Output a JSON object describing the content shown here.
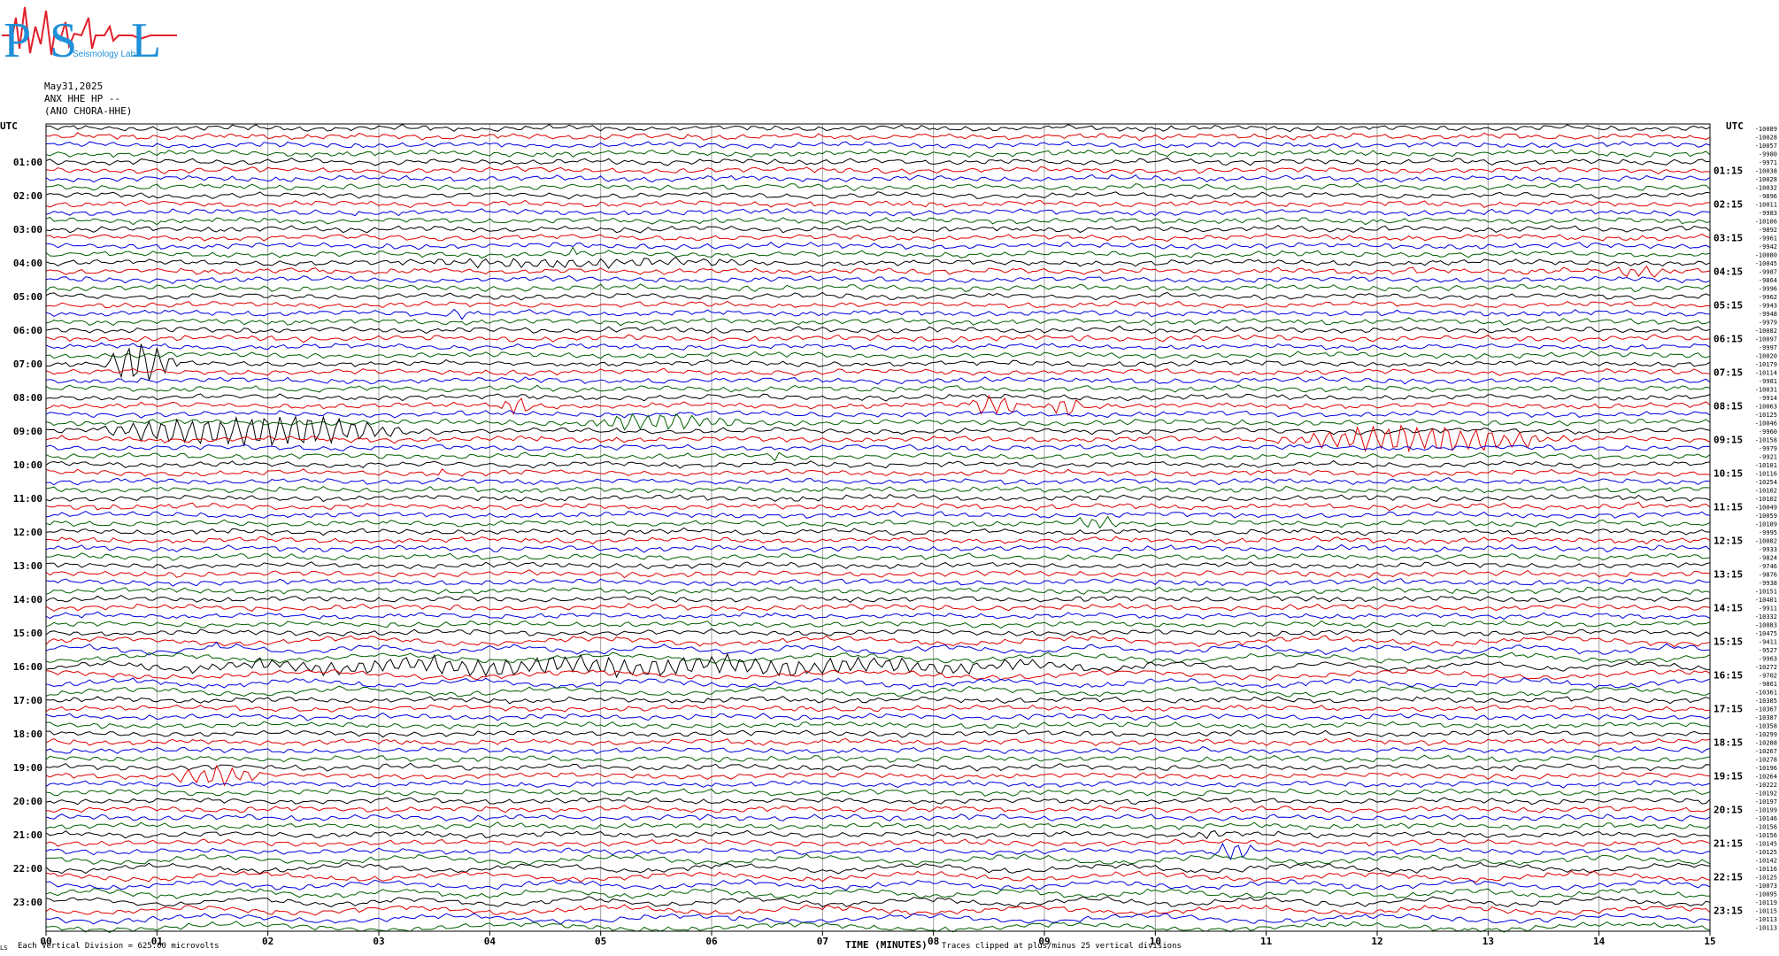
{
  "logo": {
    "big_letters": [
      "P",
      "S",
      "L"
    ],
    "small_text": "Seismology Lab",
    "colors": {
      "letters": "#1f8fd8",
      "wave": "#e0202a"
    }
  },
  "header": {
    "date": "May31,2025",
    "station": "ANX HHE HP --",
    "site": "(ANO CHORA-HHE)"
  },
  "footer": {
    "division_note": "Each Vertical Division =  625.00 microvolts",
    "xlabel": "TIME (MINUTES)",
    "clip_note": "Traces clipped at plus/minus 25 vertical divisions",
    "corner_mark": "LS"
  },
  "chart_data": {
    "type": "line",
    "title": "",
    "xlabel": "TIME (MINUTES)",
    "xlim": [
      0,
      15
    ],
    "x_ticks": [
      "00",
      "01",
      "02",
      "03",
      "04",
      "05",
      "06",
      "07",
      "08",
      "09",
      "10",
      "11",
      "12",
      "13",
      "14",
      "15"
    ],
    "left_axis_label": "UTC",
    "right_axis_label": "UTC",
    "left_time_labels": [
      "01:00",
      "02:00",
      "03:00",
      "04:00",
      "05:00",
      "06:00",
      "07:00",
      "08:00",
      "09:00",
      "10:00",
      "11:00",
      "12:00",
      "13:00",
      "14:00",
      "15:00",
      "16:00",
      "17:00",
      "18:00",
      "19:00",
      "20:00",
      "21:00",
      "22:00",
      "23:00"
    ],
    "right_time_labels": [
      "01:15",
      "02:15",
      "03:15",
      "04:15",
      "05:15",
      "06:15",
      "07:15",
      "08:15",
      "09:15",
      "10:15",
      "11:15",
      "12:15",
      "13:15",
      "14:15",
      "15:15",
      "16:15",
      "17:15",
      "18:15",
      "19:15",
      "20:15",
      "21:15",
      "22:15",
      "23:15"
    ],
    "trace_count": 96,
    "trace_color_cycle": [
      "#000000",
      "#e00000",
      "#0000e0",
      "#006000"
    ],
    "trace_offsets": [
      "-10089",
      "-10028",
      "-10057",
      "-9980",
      "-9971",
      "-10038",
      "-10028",
      "-10032",
      "-9896",
      "-10011",
      "-9983",
      "-10106",
      "-9892",
      "-9961",
      "-9942",
      "-10080",
      "-10045",
      "-9987",
      "-9864",
      "-9996",
      "-9962",
      "-9943",
      "-9948",
      "-9979",
      "-10082",
      "-10097",
      "-9997",
      "-10020",
      "-10179",
      "-10114",
      "-9981",
      "-10031",
      "-9914",
      "-10063",
      "-10125",
      "-10046",
      "-9960",
      "-10158",
      "-9979",
      "-9921",
      "-10101",
      "-10116",
      "-10254",
      "-10102",
      "-10102",
      "-10049",
      "-10059",
      "-10189",
      "-9995",
      "-10082",
      "-9933",
      "-9824",
      "-9746",
      "-9876",
      "-9938",
      "-10151",
      "-10401",
      "-9911",
      "-10332",
      "-10083",
      "-10475",
      "-9411",
      "-9527",
      "-9963",
      "-10272",
      "-9702",
      "-9861",
      "-10361",
      "-10385",
      "-10367",
      "-10387",
      "-10358",
      "-10299",
      "-10288",
      "-10267",
      "-10278",
      "-10196",
      "-10264",
      "-10222",
      "-10192",
      "-10197",
      "-10199",
      "-10146",
      "-10156",
      "-10156",
      "-10145",
      "-10125",
      "-10142",
      "-10116",
      "-10125",
      "-10073",
      "-10095",
      "-10119",
      "-10115",
      "-10113",
      "-10113"
    ],
    "events": [
      {
        "trace": 15,
        "minute": 4.7,
        "duration": 0.1,
        "amplitude": 6
      },
      {
        "trace": 16,
        "minute": 2.8,
        "duration": 4.0,
        "amplitude": 4
      },
      {
        "trace": 17,
        "minute": 12.3,
        "duration": 0.1,
        "amplitude": 6
      },
      {
        "trace": 17,
        "minute": 14.1,
        "duration": 0.6,
        "amplitude": 6
      },
      {
        "trace": 22,
        "minute": 3.5,
        "duration": 0.4,
        "amplitude": 4
      },
      {
        "trace": 28,
        "minute": 0.5,
        "duration": 0.7,
        "amplitude": 22
      },
      {
        "trace": 33,
        "minute": 4.1,
        "duration": 0.3,
        "amplitude": 10
      },
      {
        "trace": 33,
        "minute": 8.3,
        "duration": 0.5,
        "amplitude": 12
      },
      {
        "trace": 33,
        "minute": 9.0,
        "duration": 0.4,
        "amplitude": 10
      },
      {
        "trace": 35,
        "minute": 4.8,
        "duration": 1.5,
        "amplitude": 9
      },
      {
        "trace": 36,
        "minute": 0.3,
        "duration": 3.2,
        "amplitude": 16
      },
      {
        "trace": 37,
        "minute": 11.0,
        "duration": 2.8,
        "amplitude": 14
      },
      {
        "trace": 39,
        "minute": 6.5,
        "duration": 0.2,
        "amplitude": 6
      },
      {
        "trace": 41,
        "minute": 3.5,
        "duration": 0.1,
        "amplitude": 5
      },
      {
        "trace": 45,
        "minute": 14.3,
        "duration": 0.1,
        "amplitude": 6
      },
      {
        "trace": 47,
        "minute": 9.2,
        "duration": 0.6,
        "amplitude": 6
      },
      {
        "trace": 62,
        "minute": 1.5,
        "duration": 0.1,
        "amplitude": 5
      },
      {
        "trace": 64,
        "minute": 0.3,
        "duration": 10.0,
        "amplitude": 9
      },
      {
        "trace": 77,
        "minute": 1.0,
        "duration": 1.0,
        "amplitude": 10
      },
      {
        "trace": 84,
        "minute": 10.3,
        "duration": 0.3,
        "amplitude": 6
      },
      {
        "trace": 86,
        "minute": 10.5,
        "duration": 0.4,
        "amplitude": 10
      }
    ]
  }
}
